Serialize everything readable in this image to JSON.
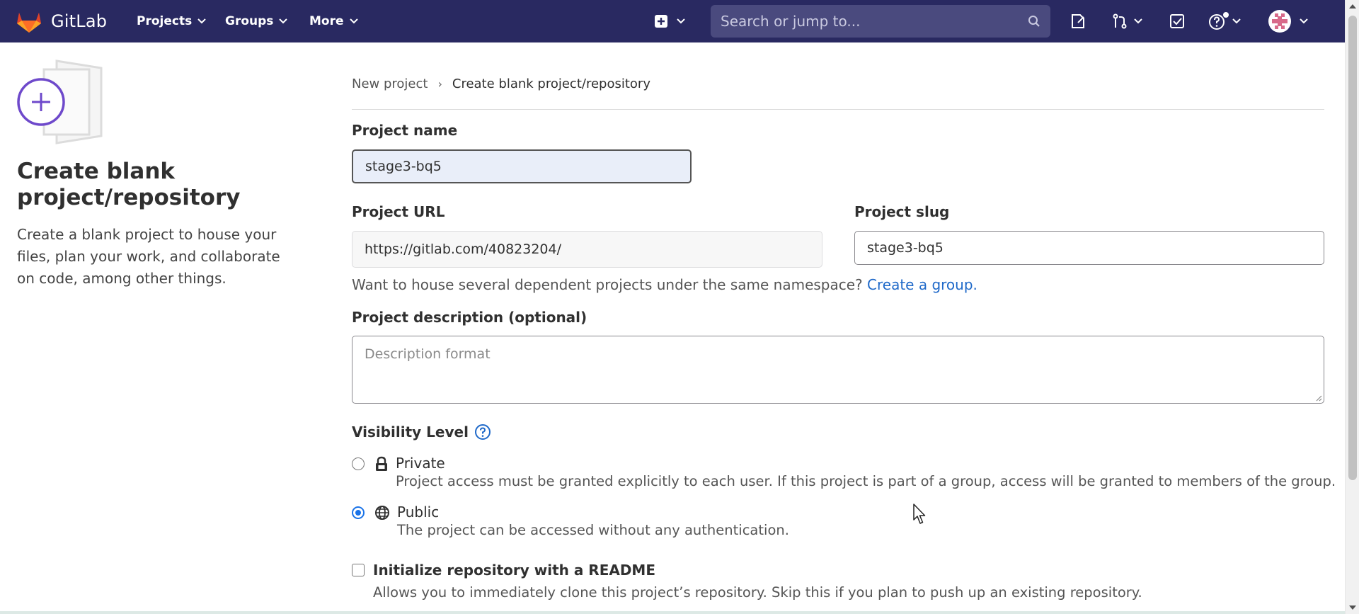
{
  "navbar": {
    "brand": "GitLab",
    "menus": [
      {
        "label": "Projects"
      },
      {
        "label": "Groups"
      },
      {
        "label": "More"
      }
    ],
    "search_placeholder": "Search or jump to...",
    "icons": [
      "plus-square-icon",
      "issues-icon",
      "merge-request-icon",
      "todo-icon",
      "help-icon",
      "avatar"
    ]
  },
  "sidebar": {
    "title": "Create blank project/repository",
    "description": "Create a blank project to house your files, plan your work, and collaborate on code, among other things."
  },
  "breadcrumb": {
    "items": [
      "New project",
      "Create blank project/repository"
    ]
  },
  "form": {
    "project_name": {
      "label": "Project name",
      "value": "stage3-bq5"
    },
    "project_url": {
      "label": "Project URL",
      "value": "https://gitlab.com/40823204/"
    },
    "project_slug": {
      "label": "Project slug",
      "value": "stage3-bq5"
    },
    "namespace_help": "Want to house several dependent projects under the same namespace?",
    "namespace_link": "Create a group.",
    "description": {
      "label": "Project description (optional)",
      "placeholder": "Description format"
    },
    "visibility": {
      "title": "Visibility Level",
      "options": [
        {
          "label": "Private",
          "description": "Project access must be granted explicitly to each user. If this project is part of a group, access will be granted to members of the group.",
          "checked": false,
          "icon": "lock-icon"
        },
        {
          "label": "Public",
          "description": "The project can be accessed without any authentication.",
          "checked": true,
          "icon": "globe-icon"
        }
      ]
    },
    "readme": {
      "label": "Initialize repository with a README",
      "description": "Allows you to immediately clone this project’s repository. Skip this if you plan to push up an existing repository.",
      "checked": false
    }
  },
  "colors": {
    "navbar_bg": "#292961",
    "search_bg": "#4a4a7e",
    "link": "#1f69c9",
    "radio_checked": "#1a73e8",
    "illustration_accent": "#6e49cb"
  }
}
